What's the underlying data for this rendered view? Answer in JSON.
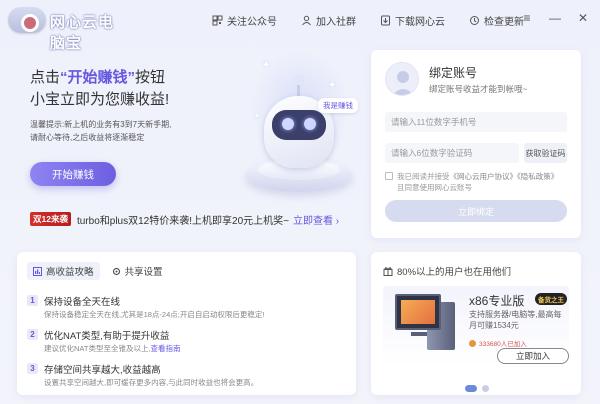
{
  "app": {
    "title": "网心云电脑宝"
  },
  "toplinks": [
    {
      "label": "关注公众号",
      "icon": "qr-icon"
    },
    {
      "label": "加入社群",
      "icon": "community-icon"
    },
    {
      "label": "下载网心云",
      "icon": "download-icon"
    },
    {
      "label": "检查更新",
      "icon": "update-icon"
    }
  ],
  "window": {
    "menu": "≡",
    "minimize": "—",
    "close": "✕"
  },
  "hero": {
    "line1_prefix": "点击",
    "line1_highlight": "“开始赚钱”",
    "line1_suffix": "按钮",
    "line2": "小宝立即为您赚收益!",
    "tip_line1": "温馨提示:新上机的业务有3到7天新手期,",
    "tip_line2": "请耐心等待,之后收益将逐渐稳定",
    "start_button": "开始赚钱",
    "robot_bubble": "我是赚钱"
  },
  "promo": {
    "badge": "双12来袭",
    "text": "turbo和plus双12特价来袭!上机即享20元上机奖~",
    "link": "立即查看 ›"
  },
  "login": {
    "title": "绑定账号",
    "subtitle": "绑定账号收益才能到帐哦~",
    "phone_placeholder": "请输入11位数字手机号",
    "code_placeholder": "请输入6位数字验证码",
    "code_button": "获取验证码",
    "agree_prefix": "我已阅读并接受",
    "agree_link1": "《网心云用户协议》",
    "agree_link2": "《隐私政策》",
    "agree_suffix": "且同意使用网心云账号",
    "bind_button": "立即绑定"
  },
  "tips": {
    "tabs": [
      {
        "label": "高收益攻略",
        "active": true
      },
      {
        "label": "共享设置",
        "active": false
      }
    ],
    "items": [
      {
        "num": "1",
        "title": "保持设备全天在线",
        "desc": "保持设备稳定全天在线,尤其是18点-24点;开启自启动权限后更稳定!",
        "link": ""
      },
      {
        "num": "2",
        "title": "优化NAT类型,有助于提升收益",
        "desc": "建议优化NAT类型至全锥及以上,",
        "link": "查看指南"
      },
      {
        "num": "3",
        "title": "存储空间共享越大,收益越高",
        "desc": "设置共享空间越大,即可缓存更多内容,与此同时收益也将会更高。",
        "link": ""
      }
    ]
  },
  "product": {
    "header": "80%以上的用户也在用他们",
    "name": "x86专业版",
    "badge": "备货之王",
    "desc": "支持服务器/电脑等,最高每月可赚1534元",
    "join_count": "333680人已加入",
    "join_button": "立即加入",
    "carousel_count": 2,
    "carousel_active": 0
  },
  "colors": {
    "accent": "#6657e0",
    "promo_red": "#c9271f",
    "bind_disabled": "#d7dbef"
  }
}
